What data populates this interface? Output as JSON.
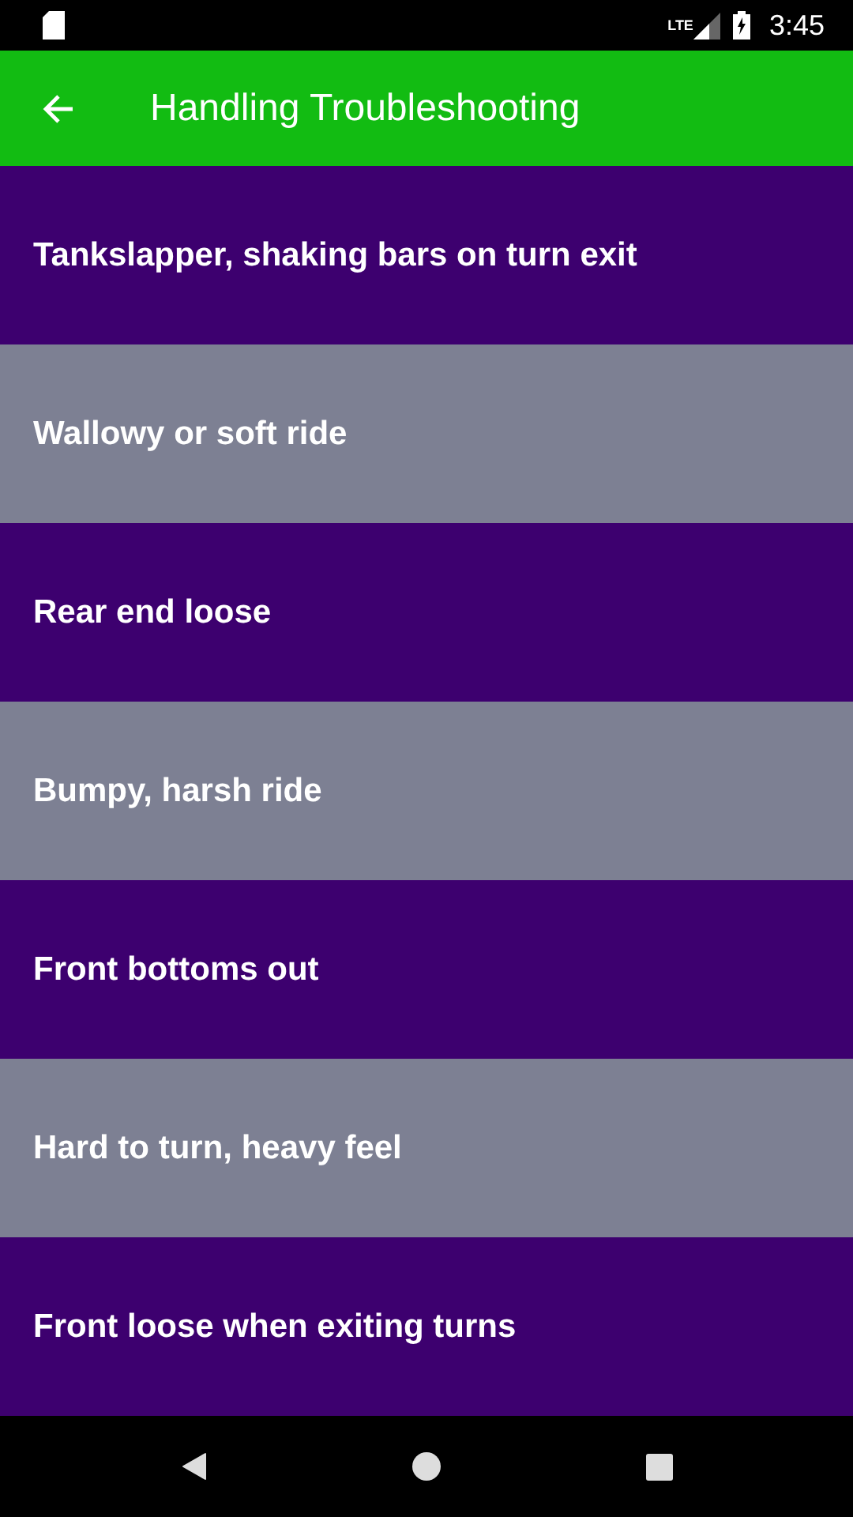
{
  "status_bar": {
    "network": "LTE",
    "time": "3:45"
  },
  "app_bar": {
    "title": "Handling Troubleshooting"
  },
  "items": [
    {
      "label": "Tankslapper, shaking bars on turn exit",
      "color": "#3d006f"
    },
    {
      "label": "Wallowy or soft ride",
      "color": "#7d8093"
    },
    {
      "label": "Rear end loose",
      "color": "#3d006f"
    },
    {
      "label": "Bumpy, harsh ride",
      "color": "#7d8093"
    },
    {
      "label": "Front bottoms out",
      "color": "#3d006f"
    },
    {
      "label": "Hard to turn, heavy feel",
      "color": "#7d8093"
    },
    {
      "label": "Front loose when exiting turns",
      "color": "#3d006f"
    }
  ]
}
